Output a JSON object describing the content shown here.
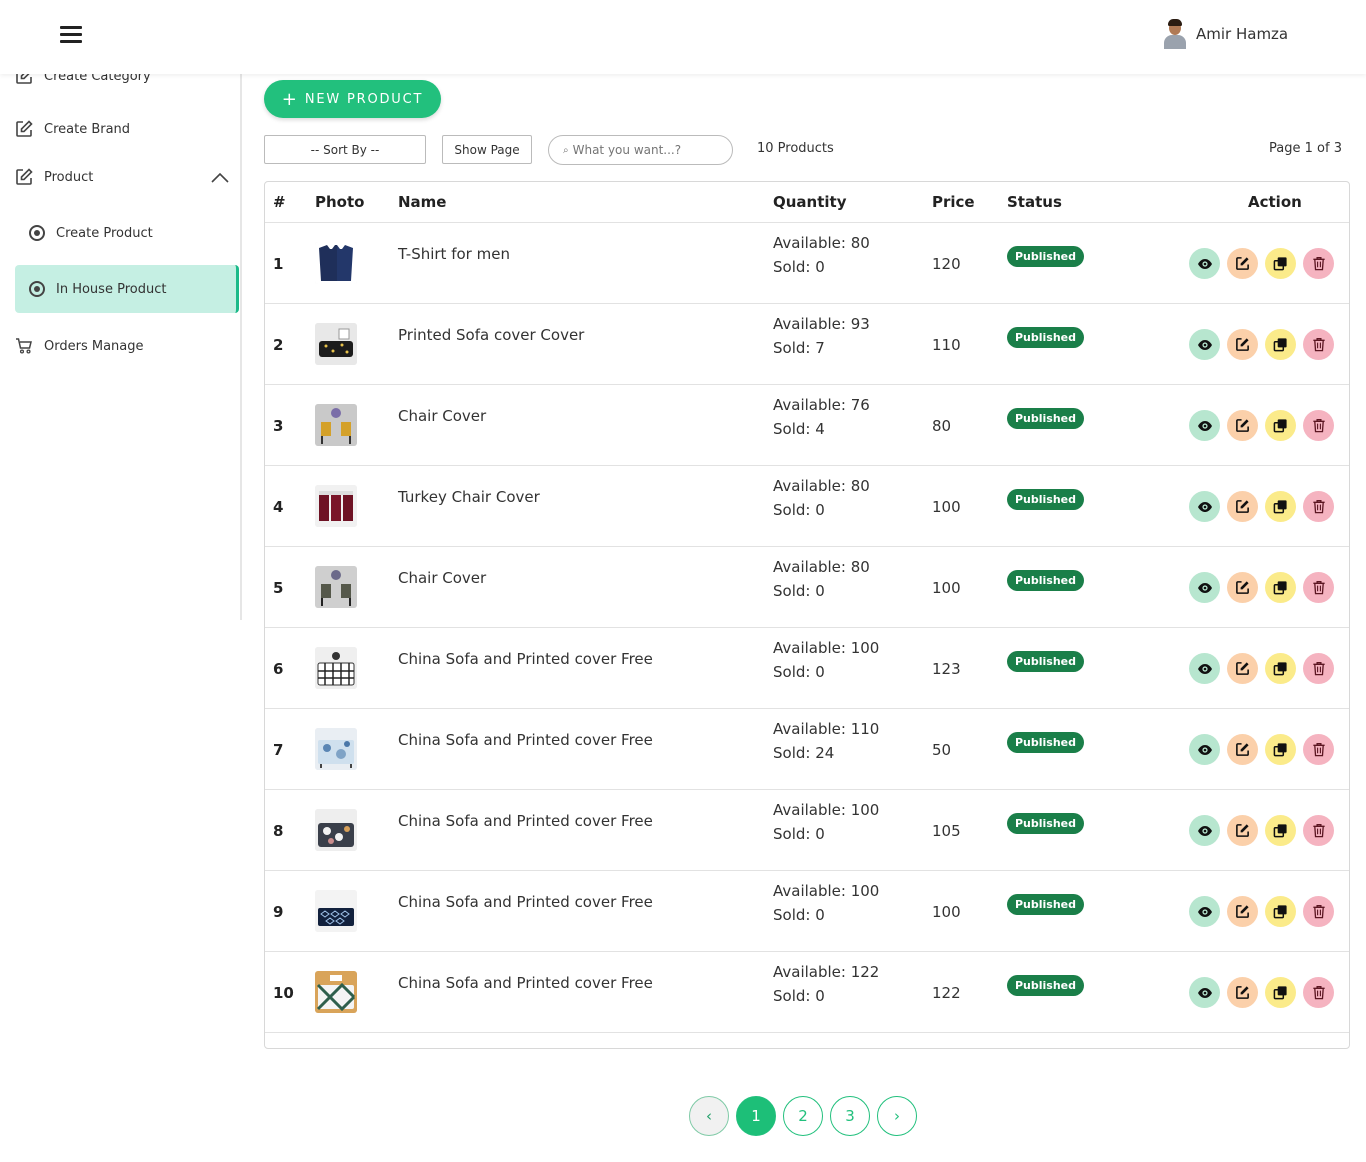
{
  "header": {
    "user_name": "Amir Hamza"
  },
  "sidebar": {
    "items": [
      {
        "label": "Create Category"
      },
      {
        "label": "Create Brand"
      },
      {
        "label": "Product"
      },
      {
        "label": "Create Product"
      },
      {
        "label": "In House Product"
      },
      {
        "label": "Orders Manage"
      }
    ]
  },
  "toolbar": {
    "new_product": "NEW PRODUCT",
    "sort_by": "-- Sort By --",
    "show_page": "Show Page",
    "search_placeholder": "What you want...?",
    "product_count": "10 Products",
    "page_info": "Page 1 of 3"
  },
  "table": {
    "headers": [
      "#",
      "Photo",
      "Name",
      "Quantity",
      "Price",
      "Status",
      "Action"
    ],
    "rows": [
      {
        "num": "1",
        "name": "T-Shirt for men",
        "available": "Available: 80",
        "sold": "Sold: 0",
        "price": "120",
        "status": "Published",
        "thumb": "tshirt"
      },
      {
        "num": "2",
        "name": "Printed Sofa cover Cover",
        "available": "Available: 93",
        "sold": "Sold: 7",
        "price": "110",
        "status": "Published",
        "thumb": "sofa-dark"
      },
      {
        "num": "3",
        "name": "Chair Cover",
        "available": "Available: 76",
        "sold": "Sold: 4",
        "price": "80",
        "status": "Published",
        "thumb": "chair-yellow"
      },
      {
        "num": "4",
        "name": "Turkey Chair Cover",
        "available": "Available: 80",
        "sold": "Sold: 0",
        "price": "100",
        "status": "Published",
        "thumb": "chair-maroon"
      },
      {
        "num": "5",
        "name": "Chair Cover",
        "available": "Available: 80",
        "sold": "Sold: 0",
        "price": "100",
        "status": "Published",
        "thumb": "chair-grey"
      },
      {
        "num": "6",
        "name": "China Sofa and Printed cover Free",
        "available": "Available: 100",
        "sold": "Sold: 0",
        "price": "123",
        "status": "Published",
        "thumb": "sofa-bw"
      },
      {
        "num": "7",
        "name": "China Sofa and Printed cover Free",
        "available": "Available: 110",
        "sold": "Sold: 24",
        "price": "50",
        "status": "Published",
        "thumb": "sofa-blue"
      },
      {
        "num": "8",
        "name": "China Sofa and Printed cover Free",
        "available": "Available: 100",
        "sold": "Sold: 0",
        "price": "105",
        "status": "Published",
        "thumb": "sofa-floral"
      },
      {
        "num": "9",
        "name": "China Sofa and Printed cover Free",
        "available": "Available: 100",
        "sold": "Sold: 0",
        "price": "100",
        "status": "Published",
        "thumb": "sofa-navy"
      },
      {
        "num": "10",
        "name": "China Sofa and Printed cover Free",
        "available": "Available: 122",
        "sold": "Sold: 0",
        "price": "122",
        "status": "Published",
        "thumb": "sofa-green"
      }
    ]
  },
  "pagination": {
    "prev": "‹",
    "pages": [
      "1",
      "2",
      "3"
    ],
    "next": "›",
    "current": "1"
  },
  "colors": {
    "accent": "#22c07d",
    "status_published": "#1a7f49",
    "active_nav": "#c5efe3"
  }
}
